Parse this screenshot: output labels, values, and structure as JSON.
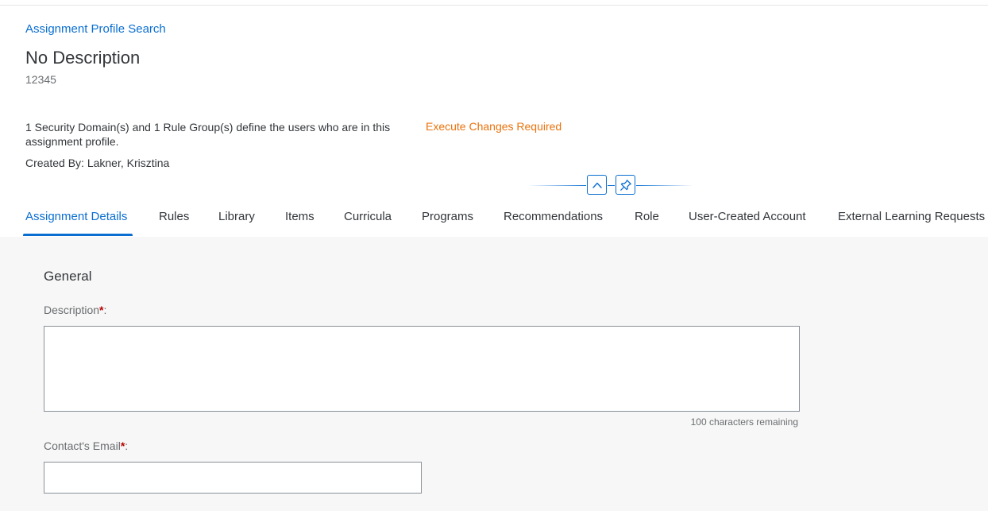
{
  "header": {
    "breadcrumb": "Assignment Profile Search",
    "title": "No Description",
    "subtitle": "12345",
    "summary": "1 Security Domain(s) and 1 Rule Group(s) define the users who are in this assignment profile.",
    "created_by": "Created By: Lakner, Krisztina",
    "status": "Execute Changes Required",
    "collapse_icon": "chevron-up-icon",
    "pin_icon": "pin-icon"
  },
  "tabs": [
    {
      "label": "Assignment Details",
      "active": true
    },
    {
      "label": "Rules"
    },
    {
      "label": "Library"
    },
    {
      "label": "Items"
    },
    {
      "label": "Curricula"
    },
    {
      "label": "Programs"
    },
    {
      "label": "Recommendations"
    },
    {
      "label": "Role"
    },
    {
      "label": "User-Created Account"
    },
    {
      "label": "External Learning Requests"
    }
  ],
  "form": {
    "section_title": "General",
    "description": {
      "label": "Description",
      "required_mark": "*",
      "suffix": ":",
      "value": "",
      "counter": "100 characters remaining"
    },
    "email": {
      "label": "Contact's Email",
      "required_mark": "*",
      "suffix": ":",
      "value": ""
    }
  },
  "colors": {
    "accent": "#0a6ed1",
    "warning": "#e9730c",
    "required": "#bb0000",
    "content_bg": "#f7f7f7"
  }
}
